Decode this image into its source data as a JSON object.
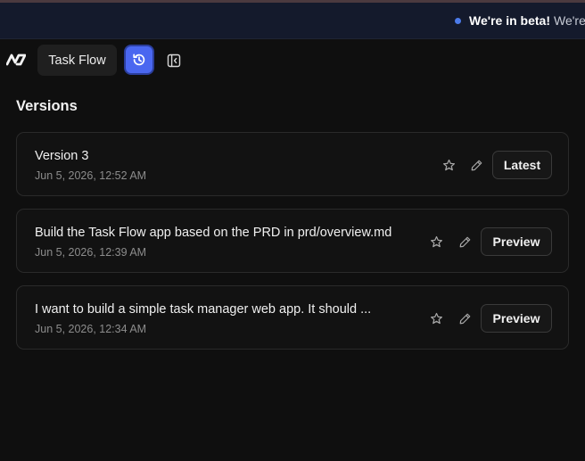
{
  "banner": {
    "strong": "We're in beta!",
    "rest": "We're"
  },
  "toolbar": {
    "project_name": "Task Flow"
  },
  "section": {
    "title": "Versions"
  },
  "versions": [
    {
      "title": "Version 3",
      "date": "Jun 5, 2026, 12:52 AM",
      "action": "Latest"
    },
    {
      "title": "Build the Task Flow app based on the PRD in prd/overview.md",
      "date": "Jun 5, 2026, 12:39 AM",
      "action": "Preview"
    },
    {
      "title": "I want to build a simple task manager web app. It should ...",
      "date": "Jun 5, 2026, 12:34 AM",
      "action": "Preview"
    }
  ],
  "icons": {
    "logo": "brand-logo",
    "history": "history-icon",
    "sidebar": "sidebar-collapse-icon",
    "star": "star-icon",
    "pencil": "pencil-icon"
  },
  "colors": {
    "accent": "#4a67f0",
    "banner_background": "#141a2c",
    "page_background": "#0f0f0f"
  }
}
